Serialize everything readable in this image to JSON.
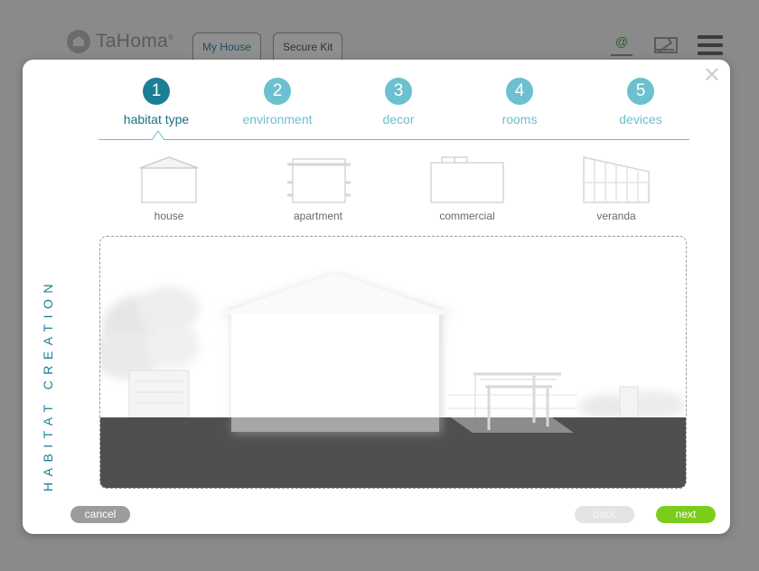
{
  "header": {
    "brand": "TaHoma",
    "brand_mark": "®",
    "tabs": [
      {
        "label": "My House",
        "active": true
      },
      {
        "label": "Secure Kit",
        "active": false
      }
    ],
    "icons": [
      "at-icon",
      "mail-icon",
      "menu-icon"
    ],
    "at_glyph": "@"
  },
  "modal": {
    "close_glyph": "✕",
    "side_title": "HABITAT CREATION",
    "steps": [
      {
        "number": "1",
        "label": "habitat type",
        "current": true
      },
      {
        "number": "2",
        "label": "environment",
        "current": false
      },
      {
        "number": "3",
        "label": "decor",
        "current": false
      },
      {
        "number": "4",
        "label": "rooms",
        "current": false
      },
      {
        "number": "5",
        "label": "devices",
        "current": false
      }
    ],
    "habitat_types": [
      {
        "label": "house",
        "icon": "house-icon"
      },
      {
        "label": "apartment",
        "icon": "apartment-icon"
      },
      {
        "label": "commercial",
        "icon": "commercial-icon"
      },
      {
        "label": "veranda",
        "icon": "veranda-icon"
      }
    ],
    "buttons": {
      "cancel": "cancel",
      "back": "back",
      "next": "next"
    }
  },
  "colors": {
    "accent_dark": "#1a7e97",
    "accent_light": "#6cc0cf",
    "next_green": "#7ccd1b",
    "ground": "#4f4f4f"
  }
}
